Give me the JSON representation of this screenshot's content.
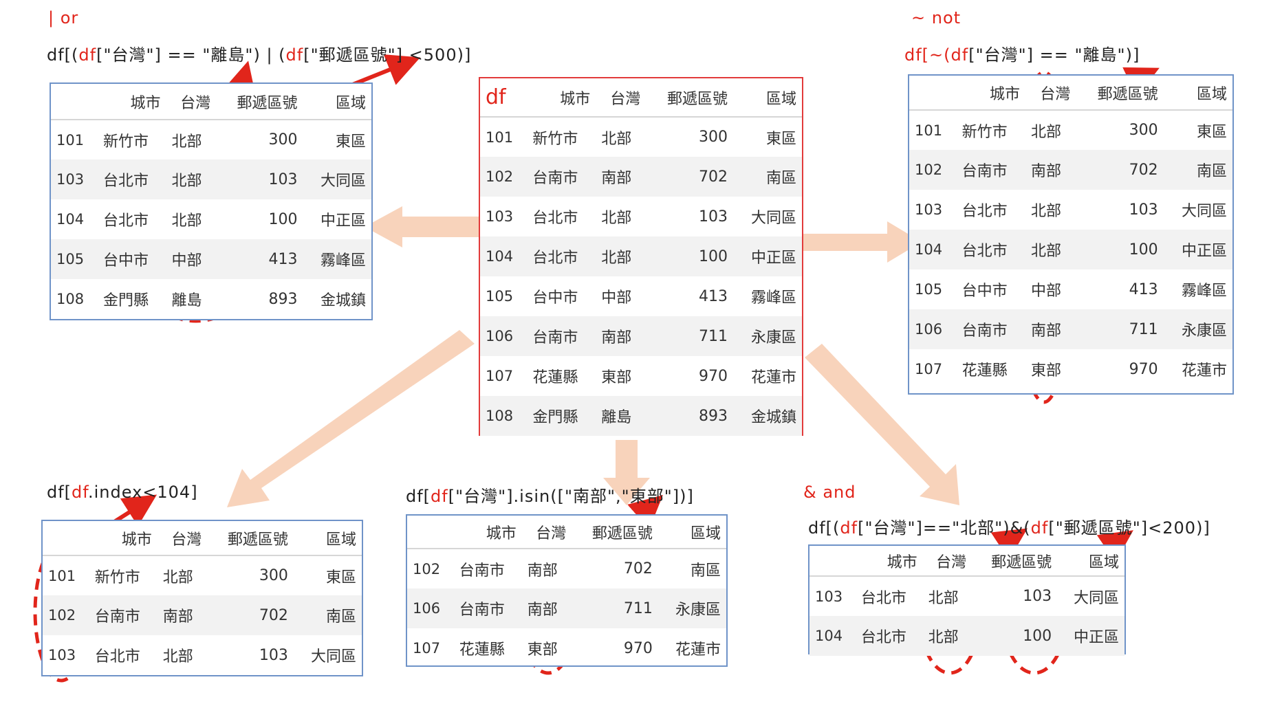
{
  "columns": [
    "城市",
    "台灣",
    "郵遞區號",
    "區域"
  ],
  "main": {
    "name": "df",
    "rows": [
      [
        "101",
        "新竹市",
        "北部",
        "300",
        "東區"
      ],
      [
        "102",
        "台南市",
        "南部",
        "702",
        "南區"
      ],
      [
        "103",
        "台北市",
        "北部",
        "103",
        "大同區"
      ],
      [
        "104",
        "台北市",
        "北部",
        "100",
        "中正區"
      ],
      [
        "105",
        "台中市",
        "中部",
        "413",
        "霧峰區"
      ],
      [
        "106",
        "台南市",
        "南部",
        "711",
        "永康區"
      ],
      [
        "107",
        "花蓮縣",
        "東部",
        "970",
        "花蓮市"
      ],
      [
        "108",
        "金門縣",
        "離島",
        "893",
        "金城鎮"
      ]
    ]
  },
  "or_panel": {
    "title": "| or",
    "code_prefix": "df[(",
    "code_df1": "df",
    "code_mid": "[\"台灣\"] == \"離島\") | (",
    "code_df2": "df",
    "code_suffix": "[\"郵遞區號\"] <500)]",
    "rows": [
      [
        "101",
        "新竹市",
        "北部",
        "300",
        "東區"
      ],
      [
        "103",
        "台北市",
        "北部",
        "103",
        "大同區"
      ],
      [
        "104",
        "台北市",
        "北部",
        "100",
        "中正區"
      ],
      [
        "105",
        "台中市",
        "中部",
        "413",
        "霧峰區"
      ],
      [
        "108",
        "金門縣",
        "離島",
        "893",
        "金城鎮"
      ]
    ]
  },
  "not_panel": {
    "title": "~ not",
    "code_prefix": "df[~(",
    "code_df1": "df",
    "code_suffix": "[\"台灣\"] == \"離島\")]",
    "rows": [
      [
        "101",
        "新竹市",
        "北部",
        "300",
        "東區"
      ],
      [
        "102",
        "台南市",
        "南部",
        "702",
        "南區"
      ],
      [
        "103",
        "台北市",
        "北部",
        "103",
        "大同區"
      ],
      [
        "104",
        "台北市",
        "北部",
        "100",
        "中正區"
      ],
      [
        "105",
        "台中市",
        "中部",
        "413",
        "霧峰區"
      ],
      [
        "106",
        "台南市",
        "南部",
        "711",
        "永康區"
      ],
      [
        "107",
        "花蓮縣",
        "東部",
        "970",
        "花蓮市"
      ]
    ]
  },
  "index_panel": {
    "code_prefix": "df[",
    "code_df1": "df",
    "code_suffix": ".index<104]",
    "rows": [
      [
        "101",
        "新竹市",
        "北部",
        "300",
        "東區"
      ],
      [
        "102",
        "台南市",
        "南部",
        "702",
        "南區"
      ],
      [
        "103",
        "台北市",
        "北部",
        "103",
        "大同區"
      ]
    ]
  },
  "isin_panel": {
    "code_prefix": "df[",
    "code_df1": "df",
    "code_suffix": "[\"台灣\"].isin([\"南部\",\"東部\"])]",
    "rows": [
      [
        "102",
        "台南市",
        "南部",
        "702",
        "南區"
      ],
      [
        "106",
        "台南市",
        "南部",
        "711",
        "永康區"
      ],
      [
        "107",
        "花蓮縣",
        "東部",
        "970",
        "花蓮市"
      ]
    ]
  },
  "and_panel": {
    "title": "& and",
    "code_prefix": "df[(",
    "code_df1": "df",
    "code_mid": "[\"台灣\"]==\"北部\")&(",
    "code_df2": "df",
    "code_suffix": "[\"郵遞區號\"]<200)]",
    "rows": [
      [
        "103",
        "台北市",
        "北部",
        "103",
        "大同區"
      ],
      [
        "104",
        "台北市",
        "北部",
        "100",
        "中正區"
      ]
    ]
  },
  "colors": {
    "accent_red": "#e1251b",
    "table_border_blue": "#6f93c8",
    "main_border_red": "#e23a3a",
    "arrow_peach": "#f8d3bb"
  }
}
